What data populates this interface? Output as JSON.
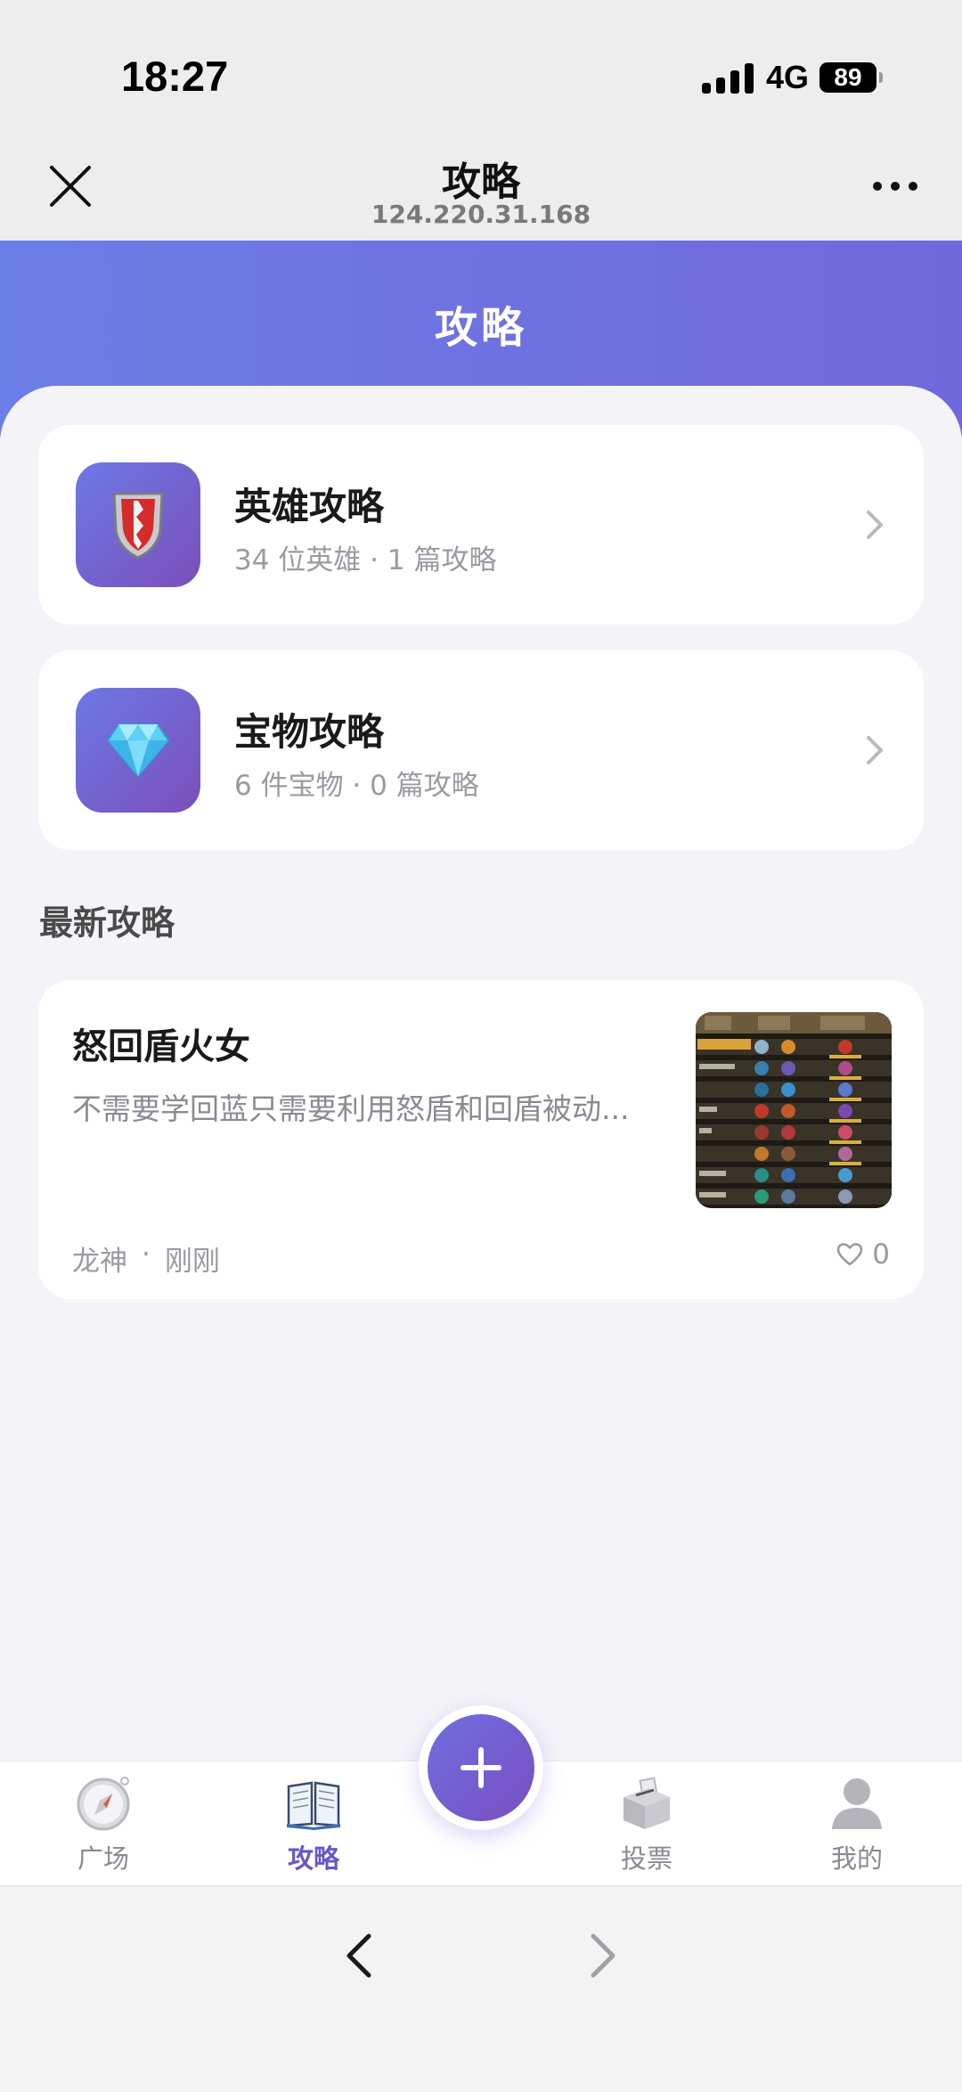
{
  "status": {
    "time": "18:27",
    "network": "4G",
    "battery": "89"
  },
  "nav": {
    "title": "攻略",
    "subtitle": "124.220.31.168"
  },
  "page": {
    "title": "攻略"
  },
  "categories": [
    {
      "title": "英雄攻略",
      "subtitle": "34 位英雄 · 1 篇攻略",
      "icon": "shield-icon"
    },
    {
      "title": "宝物攻略",
      "subtitle": "6 件宝物 · 0 篇攻略",
      "icon": "diamond-icon"
    }
  ],
  "latest": {
    "section_title": "最新攻略",
    "post": {
      "title": "怒回盾火女",
      "excerpt": "不需要学回蓝只需要利用怒盾和回盾被动...",
      "author": "龙神",
      "separator": "·",
      "time": "刚刚",
      "likes": "0"
    }
  },
  "tabs": [
    {
      "label": "广场",
      "icon": "compass-icon"
    },
    {
      "label": "攻略",
      "icon": "book-icon",
      "active": true
    },
    {
      "label": "投票",
      "icon": "ballot-box-icon"
    },
    {
      "label": "我的",
      "icon": "person-icon"
    }
  ],
  "colors": {
    "accent": "#6a55c8",
    "header_start": "#6b7de6",
    "header_end": "#7168dc"
  }
}
